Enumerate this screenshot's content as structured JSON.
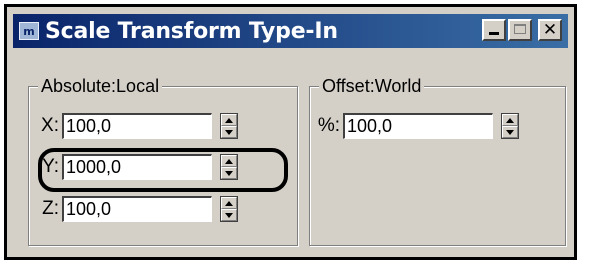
{
  "window": {
    "title": "Scale Transform Type-In",
    "app_icon": "max-app-icon",
    "controls": {
      "minimize": "minimize-icon",
      "maximize": "maximize-icon",
      "close_glyph": "✕"
    }
  },
  "absolute_group": {
    "legend": "Absolute:Local",
    "fields": [
      {
        "axis": "X:",
        "value": "100,0"
      },
      {
        "axis": "Y:",
        "value": "1000,0"
      },
      {
        "axis": "Z:",
        "value": "100,0"
      }
    ]
  },
  "offset_group": {
    "legend": "Offset:World",
    "fields": [
      {
        "axis": "%:",
        "value": "100,0"
      }
    ]
  },
  "colors": {
    "title_bar_start": "#0a246a",
    "title_bar_end": "#3a6ea5",
    "dialog_face": "#d4d0c8",
    "annotation_outline": "#000000"
  },
  "annotation": {
    "highlighted_field": "Y:"
  }
}
